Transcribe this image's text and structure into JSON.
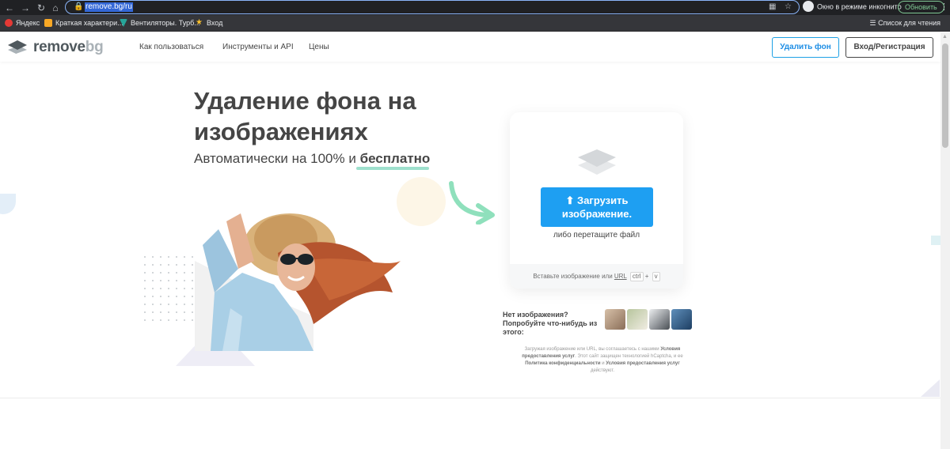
{
  "browser": {
    "url": "remove.bg/ru",
    "incognito_label": "Окно в режиме инкогнито",
    "update_label": "Обновить",
    "bookmarks": [
      {
        "label": "Яндекс",
        "color": "#e53935"
      },
      {
        "label": "Краткая характери...",
        "color": "#f9a825"
      },
      {
        "label": "Вентиляторы. Турб...",
        "color": "#26a69a"
      },
      {
        "label": "Вход",
        "color": "#fbc02d"
      }
    ],
    "reading_list": "Список для чтения"
  },
  "header": {
    "logo_main": "remove",
    "logo_bg": "bg",
    "nav": [
      "Как пользоваться",
      "Инструменты и API",
      "Цены"
    ],
    "remove_bg_button": "Удалить фон",
    "login_button": "Вход/Регистрация"
  },
  "hero": {
    "title": "Удаление фона на изображениях",
    "subtitle_prefix": "Автоматически на 100% и",
    "subtitle_free": "бесплатно"
  },
  "upload": {
    "button_label": "Загрузить изображение.",
    "drop_text": "либо перетащите файл",
    "paste_prefix": "Вставьте изображение или",
    "paste_url": "URL",
    "key_ctrl": "ctrl",
    "key_plus": "+",
    "key_v": "v"
  },
  "samples": {
    "prompt": "Нет изображения? Попробуйте что-нибудь из этого:",
    "thumb_colors": [
      "#b59a82",
      "#a7b48e",
      "#cfd2d6",
      "#3f6f9a"
    ]
  },
  "legal": {
    "p1": "Загружая изображение или URL, вы соглашаетесь с нашими",
    "terms1": "Условия предоставления услуг",
    "p2": ". Этот сайт защищен технологией hCaptcha, и ее",
    "privacy": "Политика конфиденциальности",
    "p3": "и",
    "terms2": "Условия предоставления услуг",
    "p4": "действуют."
  },
  "colors": {
    "accent": "#1e9ff2",
    "text": "#454545",
    "highlight": "#9ee0cd"
  }
}
